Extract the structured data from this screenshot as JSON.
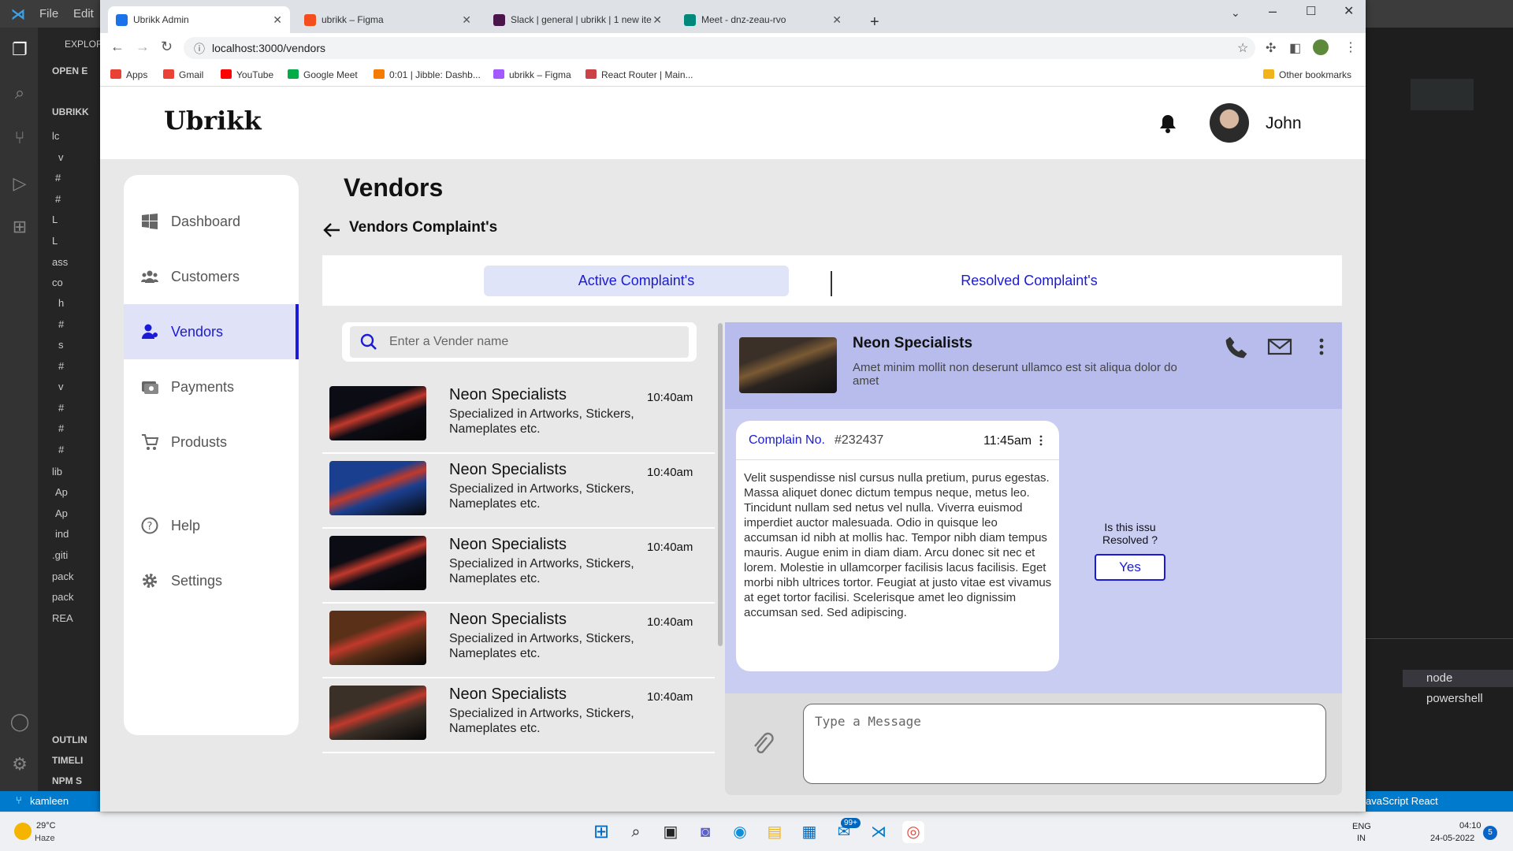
{
  "vscode": {
    "menu_file": "File",
    "menu_edit": "Edit",
    "explorer_title": "EXPLOR",
    "open_editors": "OPEN E",
    "project": "UBRIKK",
    "tree": [
      "lc",
      "v",
      "#",
      "#",
      "L",
      "L",
      "ass",
      "co",
      "h",
      "#",
      "s",
      "#",
      "v",
      "#",
      "#",
      "#",
      "lib",
      "Ap",
      "Ap",
      "ind",
      ".giti",
      "pack",
      "pack",
      "REA"
    ],
    "outline": "OUTLIN",
    "timeline": "TIMELI",
    "npm": "NPM S",
    "terminal_items": [
      "node",
      "powershell"
    ],
    "status_branch": "kamleen",
    "status_lang": "avaScript React"
  },
  "taskbar": {
    "temp": "29°C",
    "weather": "Haze",
    "lang1": "ENG",
    "lang2": "IN",
    "time": "04:10",
    "date": "24-05-2022",
    "mail_badge": "99+",
    "notif_badge": "5"
  },
  "browser": {
    "tabs": [
      {
        "title": "Ubrikk Admin",
        "color": "#1a73e8"
      },
      {
        "title": "ubrikk – Figma",
        "color": "#f24e1e"
      },
      {
        "title": "Slack | general | ubrikk | 1 new ite",
        "color": "#4a154b"
      },
      {
        "title": "Meet - dnz-zeau-rvo",
        "color": "#00897b"
      }
    ],
    "url": "localhost:3000/vendors",
    "bookmarks": [
      {
        "label": "Apps",
        "color": "#e94235"
      },
      {
        "label": "Gmail",
        "color": "#ea4335"
      },
      {
        "label": "YouTube",
        "color": "#ff0000"
      },
      {
        "label": "Google Meet",
        "color": "#00ac47"
      },
      {
        "label": "0:01 | Jibble: Dashb...",
        "color": "#f57c00"
      },
      {
        "label": "ubrikk – Figma",
        "color": "#a259ff"
      },
      {
        "label": "React Router | Main...",
        "color": "#ca4245"
      }
    ],
    "other_bookmarks": "Other bookmarks"
  },
  "app": {
    "logo": "Ubrikk",
    "user_name": "John",
    "nav": [
      "Dashboard",
      "Customers",
      "Vendors",
      "Payments",
      "Produsts",
      "Help",
      "Settings"
    ],
    "page_title": "Vendors",
    "sub_title": "Vendors Complaint's",
    "tab_active": "Active Complaint's",
    "tab_resolved": "Resolved Complaint's",
    "search_placeholder": "Enter a Vender name",
    "vendors": [
      {
        "name": "Neon Specialists",
        "desc": "Specialized in Artworks, Stickers, Nameplates etc.",
        "time": "10:40am",
        "thumb": "#0c0c14"
      },
      {
        "name": "Neon Specialists",
        "desc": "Specialized in Artworks, Stickers, Nameplates etc.",
        "time": "10:40am",
        "thumb": "#1b3f8f"
      },
      {
        "name": "Neon Specialists",
        "desc": "Specialized in Artworks, Stickers, Nameplates etc.",
        "time": "10:40am",
        "thumb": "#0c0c14"
      },
      {
        "name": "Neon Specialists",
        "desc": "Specialized in Artworks, Stickers, Nameplates etc.",
        "time": "10:40am",
        "thumb": "#5a3018"
      },
      {
        "name": "Neon Specialists",
        "desc": "Specialized in Artworks, Stickers, Nameplates etc.",
        "time": "10:40am",
        "thumb": "#3a3028"
      }
    ],
    "chat": {
      "name": "Neon Specialists",
      "desc": "Amet minim mollit non deserunt ullamco est sit aliqua dolor do amet",
      "complain_label": "Complain No.",
      "complain_no": "#232437",
      "complain_time": "11:45am",
      "complain_text": "Velit suspendisse nisl cursus nulla pretium, purus egestas. Massa aliquet donec dictum tempus neque, metus leo. Tincidunt nullam sed netus vel nulla. Viverra euismod imperdiet auctor malesuada. Odio in quisque leo accumsan id nibh at mollis hac. Tempor nibh diam tempus mauris. Augue enim in diam diam. Arcu donec sit nec et lorem. Molestie in ullamcorper facilisis lacus facilisis. Eget morbi nibh ultrices tortor. Feugiat at justo vitae est vivamus at eget tortor facilisi. Scelerisque amet leo dignissim accumsan sed. Sed adipiscing.",
      "resolved_q": "Is this issu Resolved ?",
      "yes": "Yes",
      "msg_placeholder": "Type a Message"
    }
  }
}
